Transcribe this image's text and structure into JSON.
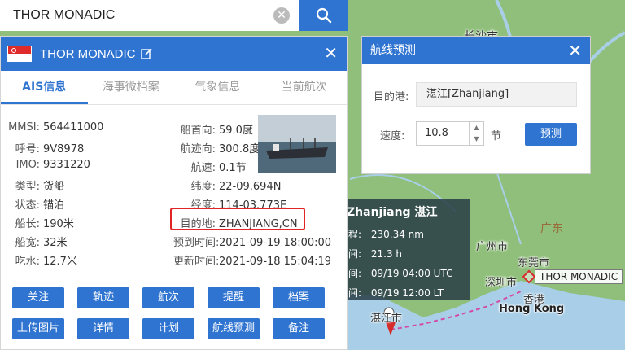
{
  "search": {
    "value": "THOR MONADIC"
  },
  "ship": {
    "name": "THOR MONADIC",
    "tabs": [
      "AIS信息",
      "海事微档案",
      "气象信息",
      "当前航次"
    ],
    "left": [
      {
        "label": "MMSI:",
        "value": "564411000"
      },
      {
        "label": "呼号:",
        "value": "9V8978"
      },
      {
        "label": "IMO:",
        "value": "9331220"
      },
      {
        "label": "类型:",
        "value": "货船"
      },
      {
        "label": "状态:",
        "value": "锚泊"
      },
      {
        "label": "船长:",
        "value": "190米"
      },
      {
        "label": "船宽:",
        "value": "32米"
      },
      {
        "label": "吃水:",
        "value": "12.7米"
      }
    ],
    "right": [
      {
        "label": "船首向:",
        "value": "59.0度"
      },
      {
        "label": "航迹向:",
        "value": "300.8度"
      },
      {
        "label": "航速:",
        "value": "0.1节"
      },
      {
        "label": "纬度:",
        "value": "22-09.694N"
      },
      {
        "label": "经度:",
        "value": "114-03.773E"
      },
      {
        "label": "目的地:",
        "value": "ZHANJIANG,CN"
      },
      {
        "label": "预到时间:",
        "value": "2021-09-19 18:00:00"
      },
      {
        "label": "更新时间:",
        "value": "2021-09-18 15:04:19"
      }
    ],
    "buttons": [
      "关注",
      "轨迹",
      "航次",
      "提醒",
      "档案",
      "上传图片",
      "详情",
      "计划",
      "航线预测",
      "备注"
    ]
  },
  "route": {
    "title": "航线预测",
    "port_label": "目的港:",
    "port_value": "湛江[Zhanjiang]",
    "speed_label": "速度:",
    "speed_value": "10.8",
    "speed_unit": "节",
    "predict_label": "预测"
  },
  "tooltip": {
    "title": "Zhanjiang 湛江",
    "lines": [
      {
        "label": "程:",
        "value": "230.34 nm"
      },
      {
        "label": "间:",
        "value": "21.3 h"
      },
      {
        "label": "间:",
        "value": "09/19 04:00 UTC"
      },
      {
        "label": "间:",
        "value": "09/19 12:00 LT"
      }
    ]
  },
  "map": {
    "labels": {
      "changsha": "长沙市",
      "guangdong": "广东",
      "guangzhou": "广州市",
      "dongguan": "东莞市",
      "shenzhen": "深圳市",
      "hongkong_cn": "香港",
      "hongkong": "Hong Kong",
      "zhanjiang": "湛江市",
      "ship": "THOR MONADIC"
    },
    "colors": {
      "land": "#8fbf7a",
      "water": "#a9cfe8",
      "route": "#d44aa8"
    }
  },
  "colors": {
    "accent": "#2f74d0",
    "highlight": "#e12424"
  }
}
